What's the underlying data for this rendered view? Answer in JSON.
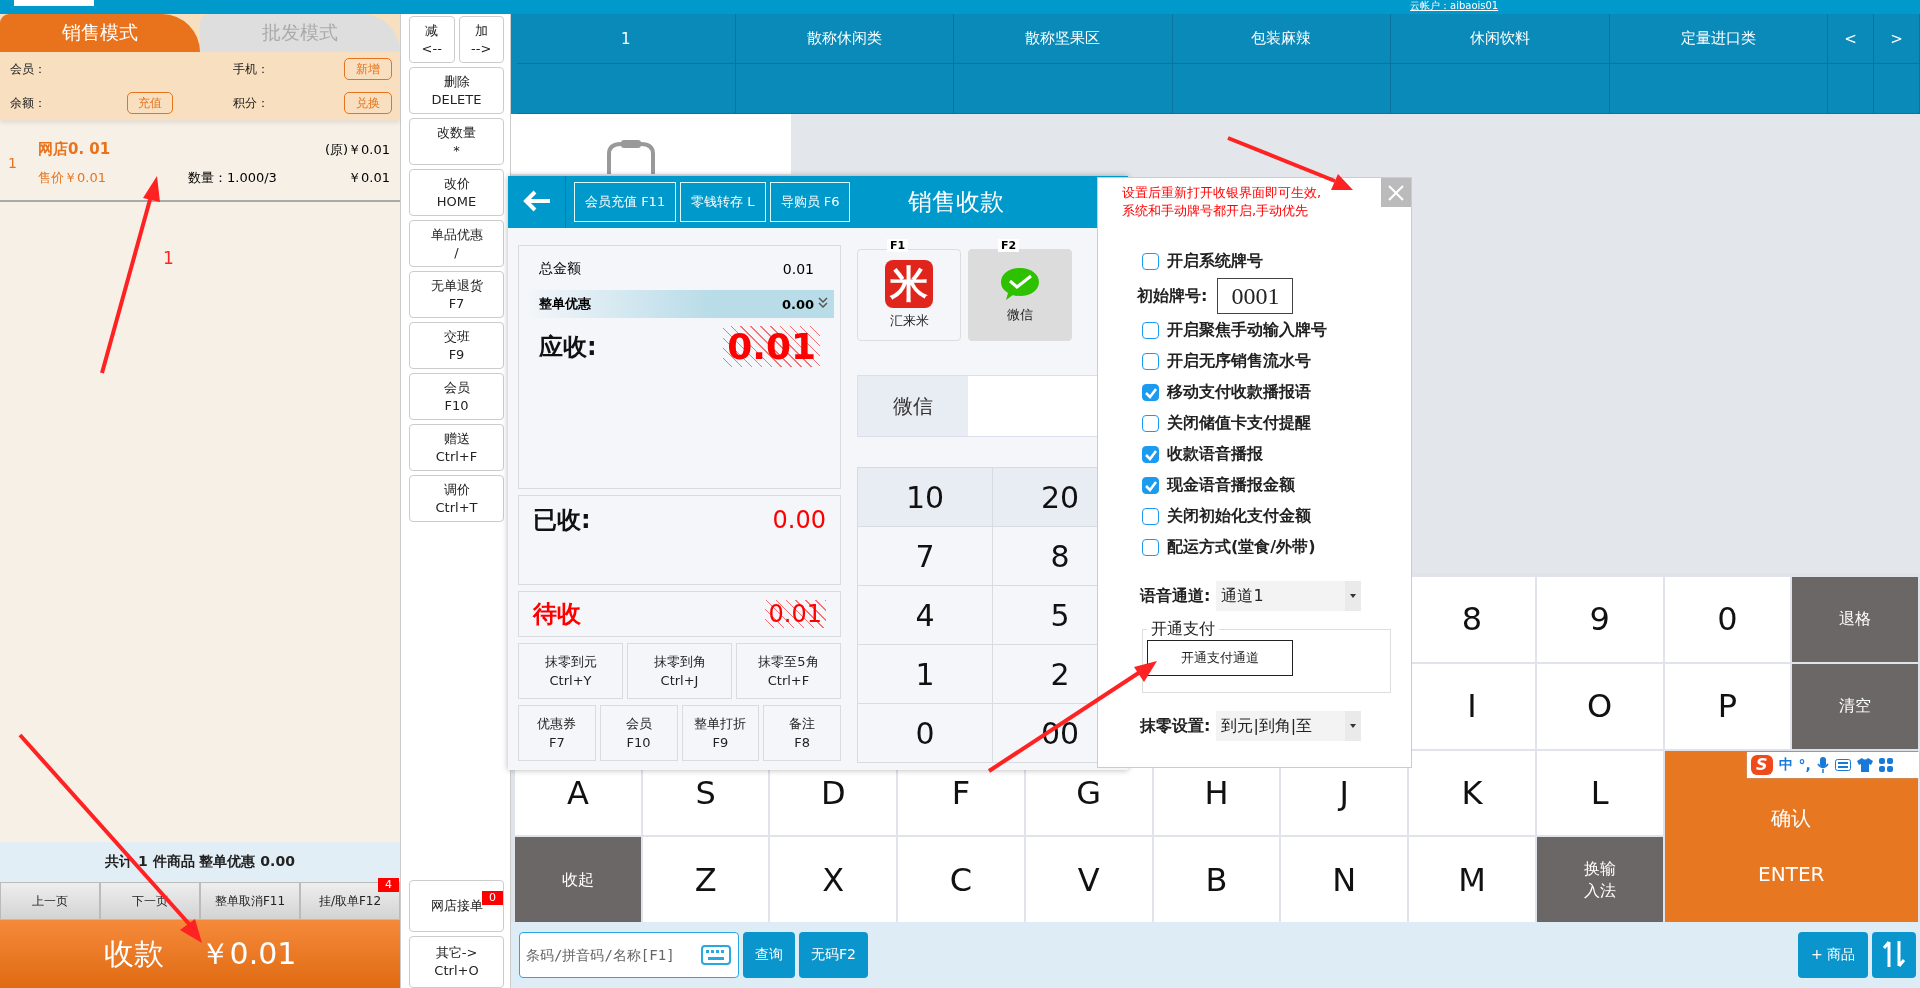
{
  "top_bar": {
    "account": "云帐户：aibaois01"
  },
  "mode_tabs": [
    {
      "label": "销售模式",
      "selected": true
    },
    {
      "label": "批发模式",
      "selected": false
    }
  ],
  "member": {
    "member_label": "会员：",
    "phone_label": "手机：",
    "add_button": "新增",
    "balance_label": "余额：",
    "recharge_button": "充值",
    "points_label": "积分：",
    "redeem_button": "兑换"
  },
  "cart_items": [
    {
      "index": "1",
      "name": "网店0. 01",
      "original_price": "(原)￥0.01",
      "sale_price": "售价￥0.01",
      "quantity": "数量：1.000/3",
      "amount": "￥0.01"
    }
  ],
  "summary": "共计 1 件商品 整单优惠 0.00",
  "list_buttons": [
    {
      "label": "上一页"
    },
    {
      "label": "下一页"
    },
    {
      "label": "整单取消F11"
    },
    {
      "label": "挂/取单F12",
      "badge": "4"
    }
  ],
  "checkout_button": {
    "label": "收款",
    "amount": "￥0.01"
  },
  "pair_buttons": [
    {
      "lines": [
        "减",
        "<--"
      ]
    },
    {
      "lines": [
        "加",
        "-->"
      ]
    }
  ],
  "side_buttons": [
    {
      "lines": [
        "删除",
        "DELETE"
      ]
    },
    {
      "lines": [
        "改数量",
        "*"
      ]
    },
    {
      "lines": [
        "改价",
        "HOME"
      ]
    },
    {
      "lines": [
        "单品优惠",
        "/"
      ]
    },
    {
      "lines": [
        "无单退货",
        "F7"
      ]
    },
    {
      "lines": [
        "交班",
        "F9"
      ]
    },
    {
      "lines": [
        "会员",
        "F10"
      ]
    },
    {
      "lines": [
        "赠送",
        "Ctrl+F"
      ]
    },
    {
      "lines": [
        "调价",
        "Ctrl+T"
      ]
    }
  ],
  "bottom_side_buttons": [
    {
      "lines": [
        "网店接单"
      ],
      "badge": "0"
    },
    {
      "lines": [
        "其它->",
        "Ctrl+O"
      ]
    }
  ],
  "categories": [
    "1",
    "散称休闲类",
    "散称坚果区",
    "包装麻辣",
    "休闲饮料",
    "定量进口类"
  ],
  "category_nav": [
    "<",
    ">"
  ],
  "keyboard": [
    {
      "keys": [
        {
          "kind": "letter",
          "label": "8"
        },
        {
          "kind": "letter",
          "label": "9"
        },
        {
          "kind": "letter",
          "label": "0"
        },
        {
          "kind": "dark",
          "label": "退格"
        }
      ]
    },
    {
      "keys": [
        {
          "kind": "letter",
          "label": "I"
        },
        {
          "kind": "letter",
          "label": "O"
        },
        {
          "kind": "letter",
          "label": "P"
        },
        {
          "kind": "dark",
          "label": "清空"
        }
      ]
    },
    {
      "keys": [
        {
          "kind": "letter",
          "label": "A"
        },
        {
          "kind": "letter",
          "label": "S"
        },
        {
          "kind": "letter",
          "label": "D"
        },
        {
          "kind": "letter",
          "label": "F"
        },
        {
          "kind": "letter",
          "label": "G"
        },
        {
          "kind": "letter",
          "label": "H"
        },
        {
          "kind": "letter",
          "label": "J"
        },
        {
          "kind": "letter",
          "label": "K"
        },
        {
          "kind": "letter",
          "label": "L"
        },
        {
          "kind": "enter",
          "label": "确认",
          "sub": "ENTER"
        }
      ]
    },
    {
      "keys": [
        {
          "kind": "dark",
          "label": "收起"
        },
        {
          "kind": "letter",
          "label": "Z"
        },
        {
          "kind": "letter",
          "label": "X"
        },
        {
          "kind": "letter",
          "label": "C"
        },
        {
          "kind": "letter",
          "label": "V"
        },
        {
          "kind": "letter",
          "label": "B"
        },
        {
          "kind": "letter",
          "label": "N"
        },
        {
          "kind": "letter",
          "label": "M"
        },
        {
          "kind": "dark",
          "label": "换输入法"
        }
      ]
    }
  ],
  "ime_bar": {
    "logo": "S",
    "labels": [
      "中",
      "°,"
    ]
  },
  "search": {
    "placeholder": "条码/拼音码/名称[F1]",
    "buttons": [
      "查询",
      "无码F2"
    ]
  },
  "add_goods_button": "+ 商品",
  "payment_dialog": {
    "header_buttons": [
      "会员充值 F11",
      "零钱转存 L",
      "导购员 F6"
    ],
    "title": "销售收款",
    "total": {
      "label": "总金额",
      "value": "0.01"
    },
    "discount": {
      "label": "整单优惠",
      "value": "0.00"
    },
    "receivable": {
      "label": "应收:",
      "value": "0.01"
    },
    "received": {
      "label": "已收:",
      "value": "0.00"
    },
    "pending": {
      "label": "待收",
      "value": "0.01"
    },
    "round_buttons": [
      {
        "lines": [
          "抹零到元",
          "Ctrl+Y"
        ]
      },
      {
        "lines": [
          "抹零到角",
          "Ctrl+J"
        ]
      },
      {
        "lines": [
          "抹零至5角",
          "Ctrl+F"
        ]
      }
    ],
    "action_buttons": [
      {
        "lines": [
          "优惠券",
          "F7"
        ]
      },
      {
        "lines": [
          "会员",
          "F10"
        ]
      },
      {
        "lines": [
          "整单打折",
          "F9"
        ]
      },
      {
        "lines": [
          "备注",
          "F8"
        ]
      }
    ],
    "methods": [
      {
        "key": "F1",
        "label": "汇来米",
        "kind": "huilaimi",
        "logo_text": "米",
        "selected": false
      },
      {
        "key": "F2",
        "label": "微信",
        "kind": "wechat",
        "selected": true
      }
    ],
    "payment_input": {
      "label": "微信"
    },
    "numpad": [
      {
        "kind": "quick",
        "keys": [
          "10",
          "20"
        ]
      },
      {
        "kind": "digit",
        "keys": [
          "7",
          "8"
        ]
      },
      {
        "kind": "digit",
        "keys": [
          "4",
          "5"
        ]
      },
      {
        "kind": "digit",
        "keys": [
          "1",
          "2"
        ]
      },
      {
        "kind": "digit",
        "keys": [
          "0",
          "00"
        ]
      }
    ]
  },
  "settings_panel": {
    "notice_lines": [
      "设置后重新打开收银界面即可生效,",
      "系统和手动牌号都开启,手动优先"
    ],
    "items": [
      {
        "kind": "checkbox",
        "label": "开启系统牌号",
        "checked": false
      },
      {
        "kind": "input",
        "label": "初始牌号:",
        "value": "0001"
      },
      {
        "kind": "checkbox",
        "label": "开启聚焦手动输入牌号",
        "checked": false
      },
      {
        "kind": "checkbox",
        "label": "开启无序销售流水号",
        "checked": false
      },
      {
        "kind": "checkbox",
        "label": "移动支付收款播报语",
        "checked": true
      },
      {
        "kind": "checkbox",
        "label": "关闭储值卡支付提醒",
        "checked": false
      },
      {
        "kind": "checkbox",
        "label": "收款语音播报",
        "checked": true
      },
      {
        "kind": "checkbox",
        "label": "现金语音播报金额",
        "checked": true
      },
      {
        "kind": "checkbox",
        "label": "关闭初始化支付金额",
        "checked": false
      },
      {
        "kind": "checkbox",
        "label": "配运方式(堂食/外带)",
        "checked": false
      }
    ],
    "voice_channel": {
      "label": "语音通道:",
      "value": "通道1"
    },
    "pay_group": {
      "legend": "开通支付",
      "button": "开通支付通道"
    },
    "rounding": {
      "label": "抹零设置:",
      "value": "到元|到角|至"
    }
  },
  "annotation": {
    "label": "1"
  }
}
